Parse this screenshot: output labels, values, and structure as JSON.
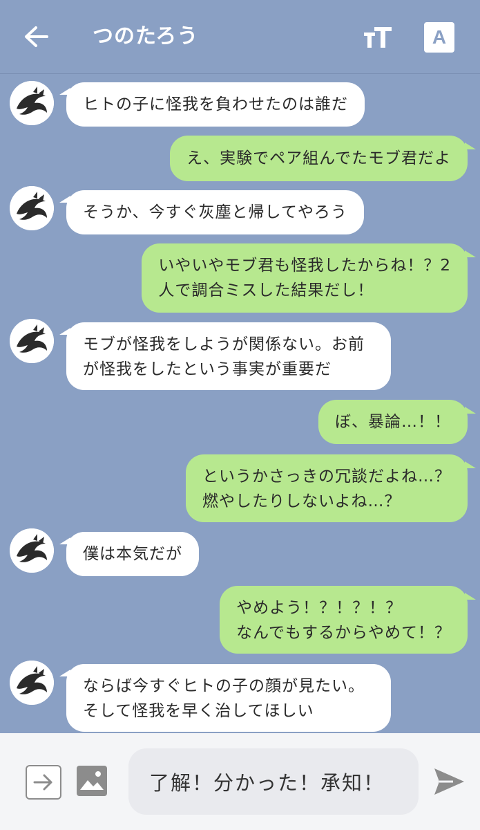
{
  "header": {
    "title": "つのたろう",
    "back_icon": "arrow-left-icon",
    "font_size_icon": "text-size-icon",
    "translate_label": "A"
  },
  "messages": [
    {
      "side": "left",
      "text": "ヒトの子に怪我を負わせたのは誰だ"
    },
    {
      "side": "right",
      "text": "え、実験でペア組んでたモブ君だよ"
    },
    {
      "side": "left",
      "text": "そうか、今すぐ灰塵と帰してやろう"
    },
    {
      "side": "right",
      "text": "いやいやモブ君も怪我したからね！？2\n人で調合ミスした結果だし！"
    },
    {
      "side": "left",
      "text": "モブが怪我をしようが関係ない。お前\nが怪我をしたという事実が重要だ"
    },
    {
      "side": "right",
      "text": "ぼ、暴論…！！"
    },
    {
      "side": "right",
      "text": "というかさっきの冗談だよね…？\n燃やしたりしないよね…？"
    },
    {
      "side": "left",
      "text": "僕は本気だが"
    },
    {
      "side": "right",
      "text": "やめよう！？！？！？\nなんでもするからやめて！？"
    },
    {
      "side": "left",
      "text": "ならば今すぐヒトの子の顔が見たい。\nそして怪我を早く治してほしい"
    }
  ],
  "composer": {
    "input_value": "了解！分かった！承知！",
    "attach_icon": "arrow-right-box-icon",
    "image_icon": "image-icon",
    "send_icon": "send-icon"
  },
  "colors": {
    "background": "#8aa0c4",
    "bubble_left": "#ffffff",
    "bubble_right": "#b7e88f"
  }
}
